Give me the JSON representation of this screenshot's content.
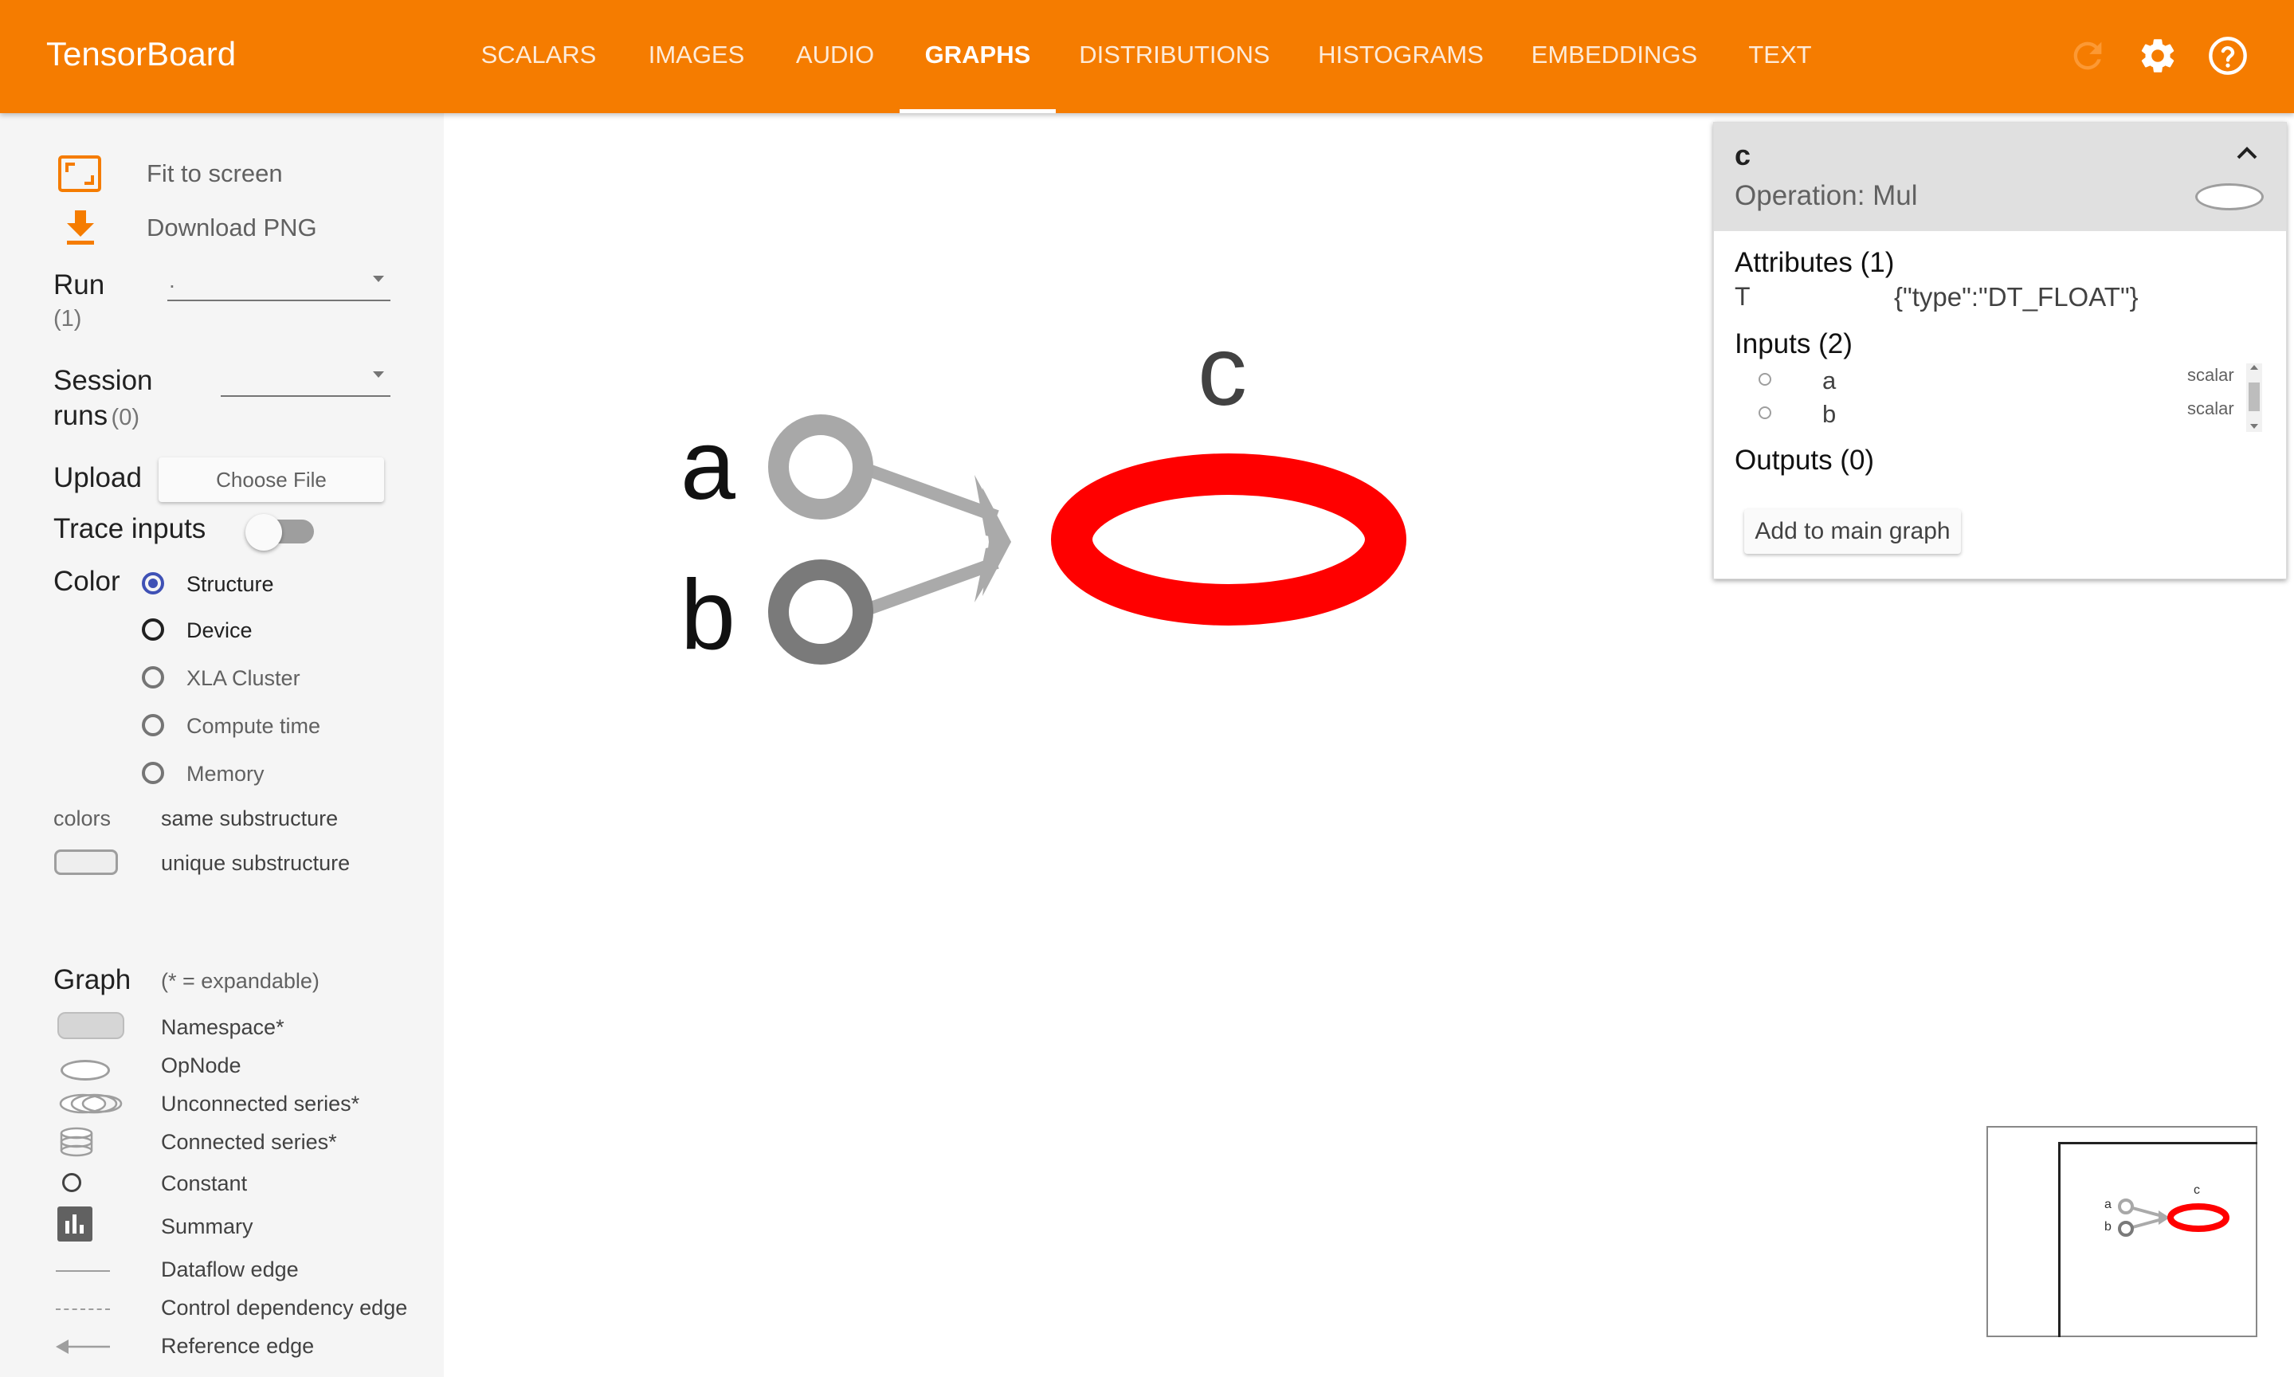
{
  "app": {
    "title": "TensorBoard"
  },
  "tabs": [
    {
      "label": "SCALARS",
      "active": false
    },
    {
      "label": "IMAGES",
      "active": false
    },
    {
      "label": "AUDIO",
      "active": false
    },
    {
      "label": "GRAPHS",
      "active": true
    },
    {
      "label": "DISTRIBUTIONS",
      "active": false
    },
    {
      "label": "HISTOGRAMS",
      "active": false
    },
    {
      "label": "EMBEDDINGS",
      "active": false
    },
    {
      "label": "TEXT",
      "active": false
    }
  ],
  "toolbar_icons": [
    "refresh-icon",
    "settings-gear-icon",
    "help-icon"
  ],
  "sidebar": {
    "fit_to_screen": "Fit to screen",
    "download_png": "Download PNG",
    "run_label": "Run",
    "run_count": "(1)",
    "run_value": ".",
    "session_label_1": "Session",
    "session_label_2": "runs",
    "session_count": "(0)",
    "session_value": "",
    "upload_label": "Upload",
    "choose_file": "Choose File",
    "trace_inputs": "Trace inputs",
    "trace_inputs_on": false,
    "color_label": "Color",
    "color_options": [
      {
        "label": "Structure",
        "checked": true
      },
      {
        "label": "Device",
        "checked": false
      },
      {
        "label": "XLA Cluster",
        "checked": false
      },
      {
        "label": "Compute time",
        "checked": false
      },
      {
        "label": "Memory",
        "checked": false
      }
    ],
    "colors_label": "colors",
    "same_substructure": "same substructure",
    "unique_substructure": "unique substructure",
    "graph_label": "Graph",
    "expandable_note": "(* = expandable)",
    "legend": {
      "namespace": "Namespace*",
      "opnode": "OpNode",
      "unconnected": "Unconnected series*",
      "connected": "Connected series*",
      "constant": "Constant",
      "summary": "Summary",
      "dataflow": "Dataflow edge",
      "control": "Control dependency edge",
      "reference": "Reference edge"
    }
  },
  "graph": {
    "nodes": [
      {
        "name": "a",
        "kind": "constant"
      },
      {
        "name": "b",
        "kind": "constant"
      },
      {
        "name": "c",
        "kind": "opnode",
        "selected": true
      }
    ],
    "edges": [
      [
        "a",
        "c"
      ],
      [
        "b",
        "c"
      ]
    ],
    "colors": {
      "a": "#a8a8a8",
      "b": "#7a7a7a",
      "edge": "#aaaaaa",
      "selected": "#ff0000",
      "accent": "#f57c00"
    }
  },
  "info_card": {
    "node_name": "c",
    "operation": "Operation: Mul",
    "attributes_title": "Attributes (1)",
    "attributes": [
      {
        "key": "T",
        "value": "{\"type\":\"DT_FLOAT\"}"
      }
    ],
    "inputs_title": "Inputs (2)",
    "inputs": [
      {
        "name": "a",
        "shape": "scalar"
      },
      {
        "name": "b",
        "shape": "scalar"
      }
    ],
    "outputs_title": "Outputs (0)",
    "add_to_main": "Add to main graph"
  },
  "minimap": {
    "labels": [
      "a",
      "b",
      "c"
    ]
  }
}
